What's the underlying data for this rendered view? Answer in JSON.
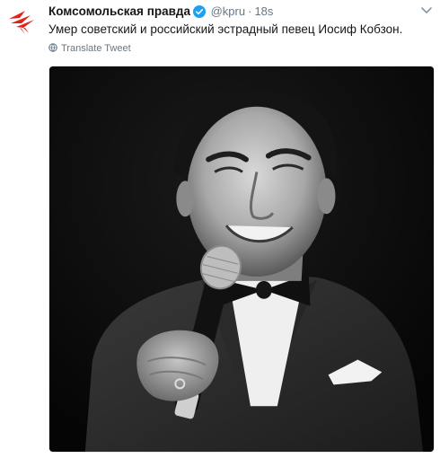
{
  "tweet": {
    "display_name": "Комсомольская правда",
    "handle": "@kpru",
    "separator": "·",
    "time": "18s",
    "text": "Умер советский и российский эстрадный певец Иосиф Кобзон.",
    "translate_label": "Translate Tweet",
    "verified": true
  },
  "colors": {
    "brand_red": "#e2231a",
    "verified_blue": "#1da1f2",
    "secondary_text": "#657786"
  },
  "media": {
    "description_icon": "photo"
  }
}
